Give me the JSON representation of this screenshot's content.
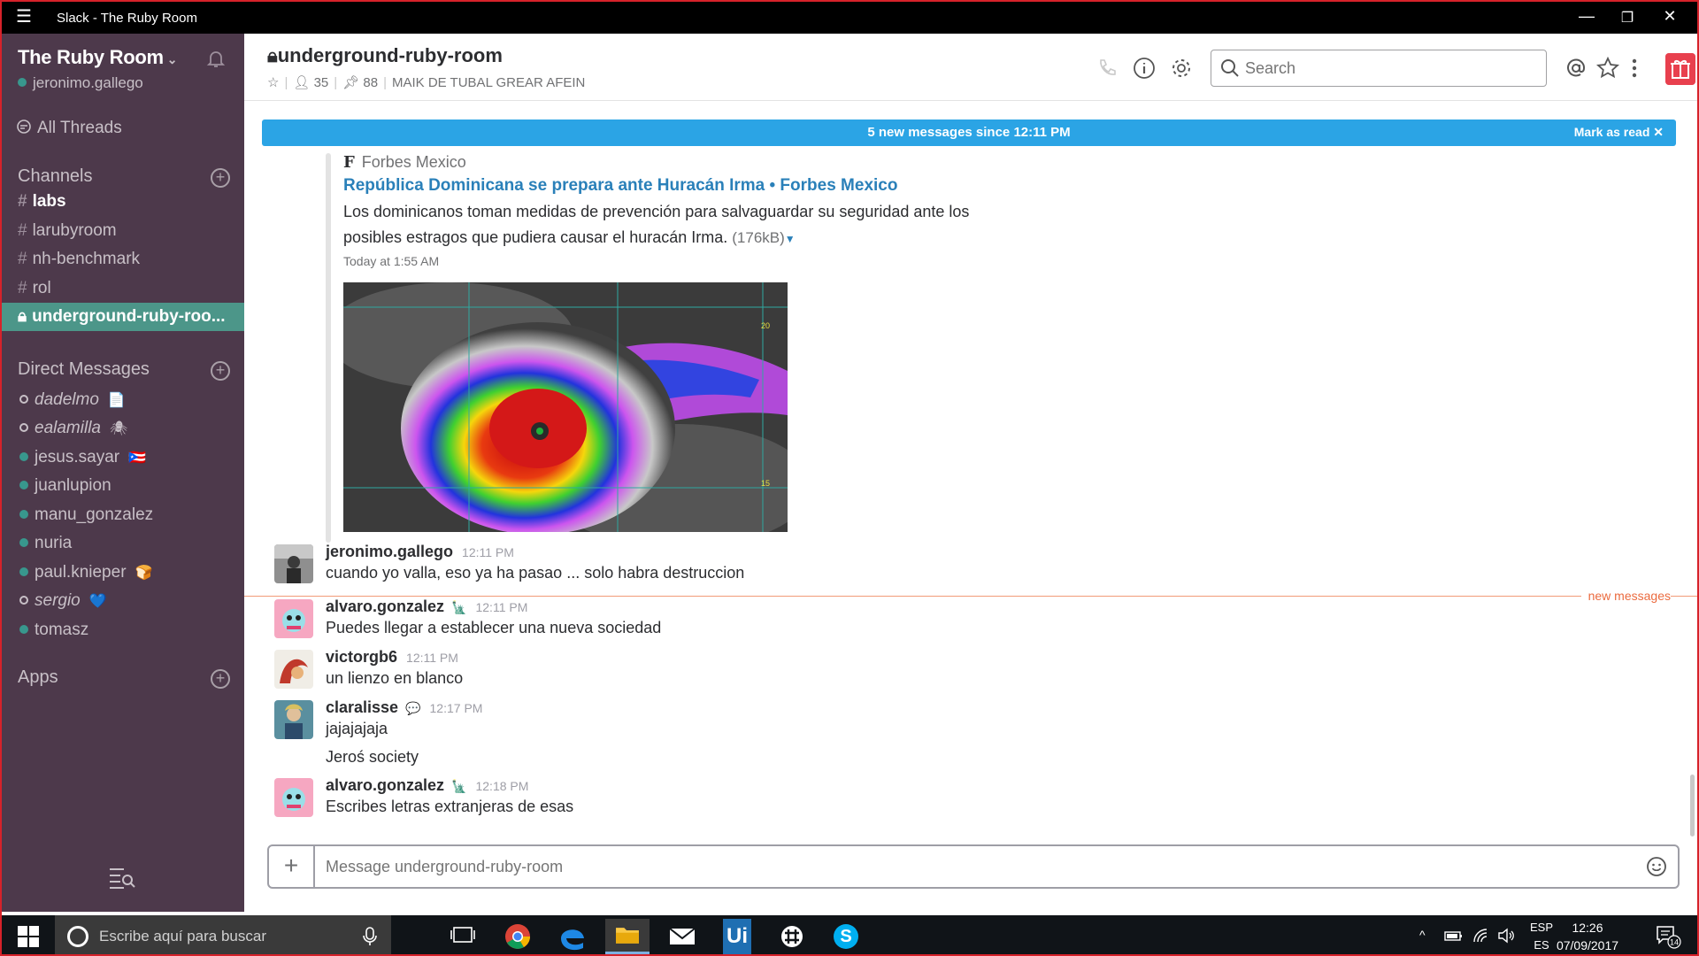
{
  "window": {
    "title": "Slack - The Ruby Room"
  },
  "team": {
    "name": "The Ruby Room",
    "user": "jeronimo.gallego"
  },
  "sidebar": {
    "all_threads": "All Threads",
    "channels_label": "Channels",
    "channels": [
      {
        "name": "labs"
      },
      {
        "name": "larubyroom"
      },
      {
        "name": "nh-benchmark"
      },
      {
        "name": "rol"
      },
      {
        "name": "underground-ruby-roo..."
      }
    ],
    "dm_label": "Direct Messages",
    "dms": [
      {
        "name": "dadelmo",
        "status": "away",
        "emoji": "📄"
      },
      {
        "name": "ealamilla",
        "status": "away",
        "emoji": "🕷"
      },
      {
        "name": "jesus.sayar",
        "status": "active",
        "emoji": "🇵🇷"
      },
      {
        "name": "juanlupion",
        "status": "active",
        "emoji": ""
      },
      {
        "name": "manu_gonzalez",
        "status": "active",
        "emoji": ""
      },
      {
        "name": "nuria",
        "status": "active",
        "emoji": ""
      },
      {
        "name": "paul.knieper",
        "status": "active",
        "emoji": "🍞"
      },
      {
        "name": "sergio",
        "status": "away",
        "emoji": "💙"
      },
      {
        "name": "tomasz",
        "status": "active",
        "emoji": ""
      }
    ],
    "apps_label": "Apps"
  },
  "channel": {
    "title": "underground-ruby-room",
    "members": "35",
    "pins": "88",
    "topic": "MAIK DE TUBAL GREAR AFEIN"
  },
  "search": {
    "placeholder": "Search"
  },
  "banner": {
    "text": "5 new messages since 12:11 PM",
    "mark_read": "Mark as read"
  },
  "attachment": {
    "source": "Forbes Mexico",
    "source_logo": "F",
    "title": "República Dominicana se prepara ante Huracán Irma • Forbes Mexico",
    "description": "Los dominicanos toman medidas de prevención para salvaguardar su seguridad ante los posibles estragos que pudiera causar el huracán Irma.",
    "size": "(176kB)",
    "time": "Today at 1:55 AM",
    "map_labels": {
      "lat_a": "20",
      "lat_b": "15"
    }
  },
  "messages": [
    {
      "author": "jeronimo.gallego",
      "badge": "",
      "time": "12:11 PM",
      "lines": [
        "cuando yo valla, eso ya ha pasao ... solo habra destruccion"
      ]
    },
    {
      "author": "alvaro.gonzalez",
      "badge": "🗽",
      "time": "12:11 PM",
      "lines": [
        "Puedes llegar a establecer una nueva sociedad"
      ]
    },
    {
      "author": "victorgb6",
      "badge": "",
      "time": "12:11 PM",
      "lines": [
        "un lienzo en blanco"
      ]
    },
    {
      "author": "claralisse",
      "badge": "💬",
      "time": "12:17 PM",
      "lines": [
        "jajajajaja",
        "Jeroś society"
      ]
    },
    {
      "author": "alvaro.gonzalez",
      "badge": "🗽",
      "time": "12:18 PM",
      "lines": [
        "Escribes letras extranjeras de esas"
      ]
    }
  ],
  "new_messages_label": "new messages",
  "composer": {
    "placeholder": "Message underground-ruby-room"
  },
  "taskbar": {
    "search_placeholder": "Escribe aquí para buscar",
    "apps": [
      "task-view",
      "chrome",
      "edge",
      "file-explorer",
      "mail",
      "uipath",
      "slack",
      "skype"
    ],
    "uipath_label": "Ui",
    "skype_label": "S",
    "lang_top": "ESP",
    "lang_bottom": "ES",
    "time": "12:26",
    "date": "07/09/2017",
    "notifications": "14"
  },
  "colors": {
    "sidebar_bg": "#4d394b",
    "active_channel": "#4c9689",
    "banner": "#2ba4e5",
    "link": "#2a80b9",
    "new_divider": "#eb6b3f"
  }
}
